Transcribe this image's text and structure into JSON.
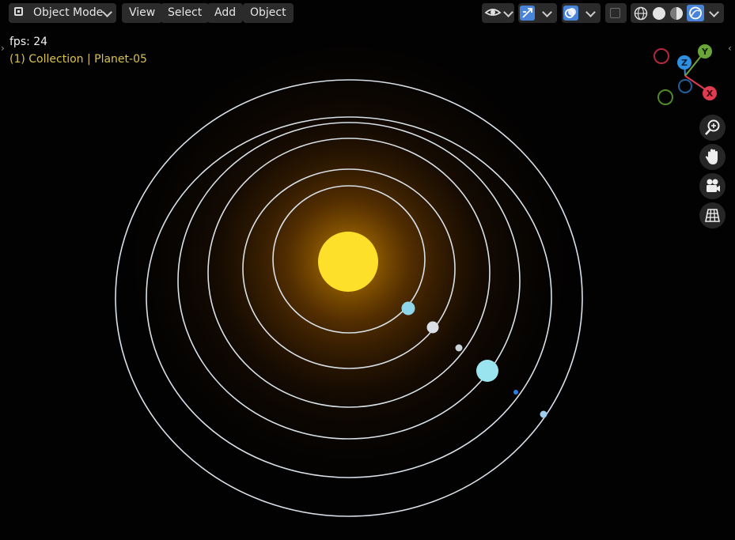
{
  "header": {
    "mode_label": "Object Mode",
    "menu": [
      "View",
      "Select",
      "Add",
      "Object"
    ]
  },
  "overlay": {
    "fps": "fps: 24",
    "collection": "(1) Collection | Planet-05"
  },
  "gizmo": {
    "x": "X",
    "y": "Y",
    "z": "Z"
  },
  "colors": {
    "accent": "#4a84d8",
    "sun": "#fde02a",
    "orbit": "#dfe9f2",
    "overlay_highlight": "#d9c24d",
    "axis_x": "#e03b4f",
    "axis_y": "#6ba53a",
    "axis_z": "#2f8fe0"
  },
  "icons": [
    "object-mode-icon",
    "eye-icon",
    "gizmo-icon",
    "overlay-icon",
    "xray-icon",
    "wireframe-icon",
    "solid-icon",
    "material-icon",
    "rendered-icon",
    "zoom-icon",
    "hand-icon",
    "camera-icon",
    "grid-icon"
  ]
}
